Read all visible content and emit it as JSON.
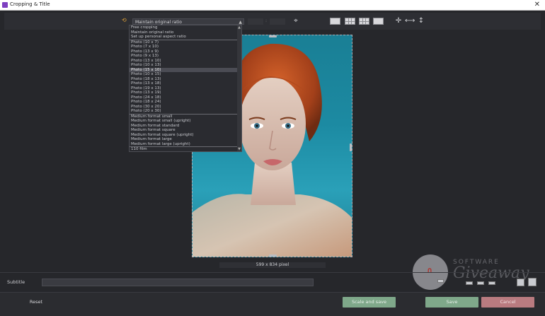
{
  "window": {
    "title": "Cropping & Title",
    "close_glyph": "✕"
  },
  "toolbar": {
    "ratio_selected": "Maintain original ratio",
    "size_separator": ":",
    "icons": [
      "rotate-ratio-icon",
      "center-target-icon",
      "grid-none-icon",
      "grid-thirds-icon",
      "grid-fine-icon",
      "grid-diagonal-icon",
      "crosshair-icon",
      "horizontal-arrows-icon",
      "vertical-arrows-icon"
    ]
  },
  "dropdown": {
    "options": [
      {
        "label": "Free cropping"
      },
      {
        "label": "Maintain original ratio"
      },
      {
        "label": "Set up personal aspect ratio",
        "sep": true
      },
      {
        "label": "Photo (10 x 7)"
      },
      {
        "label": "Photo (7 x 10)"
      },
      {
        "label": "Photo (13 x 9)"
      },
      {
        "label": "Photo (9 x 13)"
      },
      {
        "label": "Photo (13 x 10)"
      },
      {
        "label": "Photo (10 x 13)"
      },
      {
        "label": "Photo (15 x 10)",
        "selected": true
      },
      {
        "label": "Photo (10 x 15)"
      },
      {
        "label": "Photo (18 x 13)"
      },
      {
        "label": "Photo (13 x 18)"
      },
      {
        "label": "Photo (19 x 13)"
      },
      {
        "label": "Photo (13 x 19)"
      },
      {
        "label": "Photo (24 x 18)"
      },
      {
        "label": "Photo (18 x 24)"
      },
      {
        "label": "Photo (30 x 20)"
      },
      {
        "label": "Photo (20 x 30)",
        "sep": true
      },
      {
        "label": "Medium format small"
      },
      {
        "label": "Medium format small (upright)"
      },
      {
        "label": "Medium format standard"
      },
      {
        "label": "Medium format square"
      },
      {
        "label": "Medium format square (upright)"
      },
      {
        "label": "Medium format large"
      },
      {
        "label": "Medium format large (upright)",
        "sep": true
      },
      {
        "label": "110 film"
      }
    ]
  },
  "image": {
    "pixel_info": "599 x 834 pixel"
  },
  "subtitle": {
    "label": "Subtitle",
    "value": ""
  },
  "buttons": {
    "reset": "Reset",
    "scale_and_save": "Scale and save",
    "save": "Save",
    "cancel": "Cancel"
  },
  "watermark": {
    "line1": "SOFTWARE",
    "line2": "Giveaway",
    "logo": "∩"
  },
  "colors": {
    "accent_ok": "#7fa88a",
    "accent_cancel": "#b97b80",
    "background": "#26272b"
  }
}
